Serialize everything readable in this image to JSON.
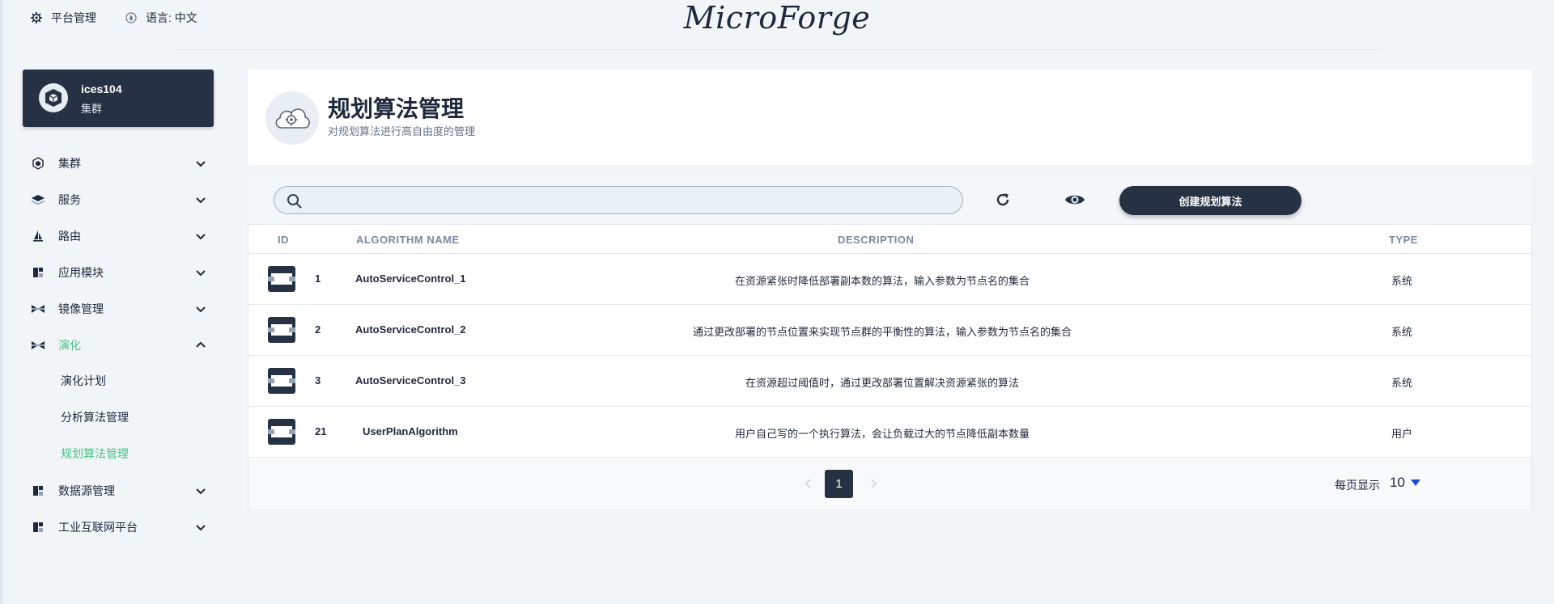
{
  "topbar": {
    "platform_label": "平台管理",
    "language_label": "语言: 中文",
    "brand": "MicroForge"
  },
  "cluster": {
    "name": "ices104",
    "subtitle": "集群"
  },
  "sidebar": {
    "items": [
      {
        "label": "集群",
        "icon": "hexagon-icon"
      },
      {
        "label": "服务",
        "icon": "layers-icon"
      },
      {
        "label": "路由",
        "icon": "sail-icon"
      },
      {
        "label": "应用模块",
        "icon": "module-icon"
      },
      {
        "label": "镜像管理",
        "icon": "image-icon"
      },
      {
        "label": "演化",
        "icon": "image-icon",
        "expanded": true,
        "active": true
      },
      {
        "label": "数据源管理",
        "icon": "module-icon"
      },
      {
        "label": "工业互联网平台",
        "icon": "module-icon"
      }
    ],
    "sub_items": [
      {
        "label": "演化计划"
      },
      {
        "label": "分析算法管理"
      },
      {
        "label": "规划算法管理",
        "active": true
      }
    ]
  },
  "header": {
    "title": "规划算法管理",
    "subtitle": "对规划算法进行高自由度的管理"
  },
  "toolbar": {
    "search_placeholder": "",
    "create_label": "创建规划算法"
  },
  "table": {
    "columns": [
      "ID",
      "ALGORITHM NAME",
      "DESCRIPTION",
      "TYPE"
    ],
    "rows": [
      {
        "id": "1",
        "name": "AutoServiceControl_1",
        "description": "在资源紧张时降低部署副本数的算法，输入参数为节点名的集合",
        "type": "系统"
      },
      {
        "id": "2",
        "name": "AutoServiceControl_2",
        "description": "通过更改部署的节点位置来实现节点群的平衡性的算法，输入参数为节点名的集合",
        "type": "系统"
      },
      {
        "id": "3",
        "name": "AutoServiceControl_3",
        "description": "在资源超过阈值时，通过更改部署位置解决资源紧张的算法",
        "type": "系统"
      },
      {
        "id": "21",
        "name": "UserPlanAlgorithm",
        "description": "用户自己写的一个执行算法，会让负载过大的节点降低副本数量",
        "type": "用户"
      }
    ]
  },
  "pagination": {
    "current_page": "1",
    "per_page_label": "每页显示",
    "per_page_value": "10"
  },
  "colors": {
    "navy": "#263143",
    "accent_green": "#4bbf87",
    "background": "#f1f5f8"
  }
}
